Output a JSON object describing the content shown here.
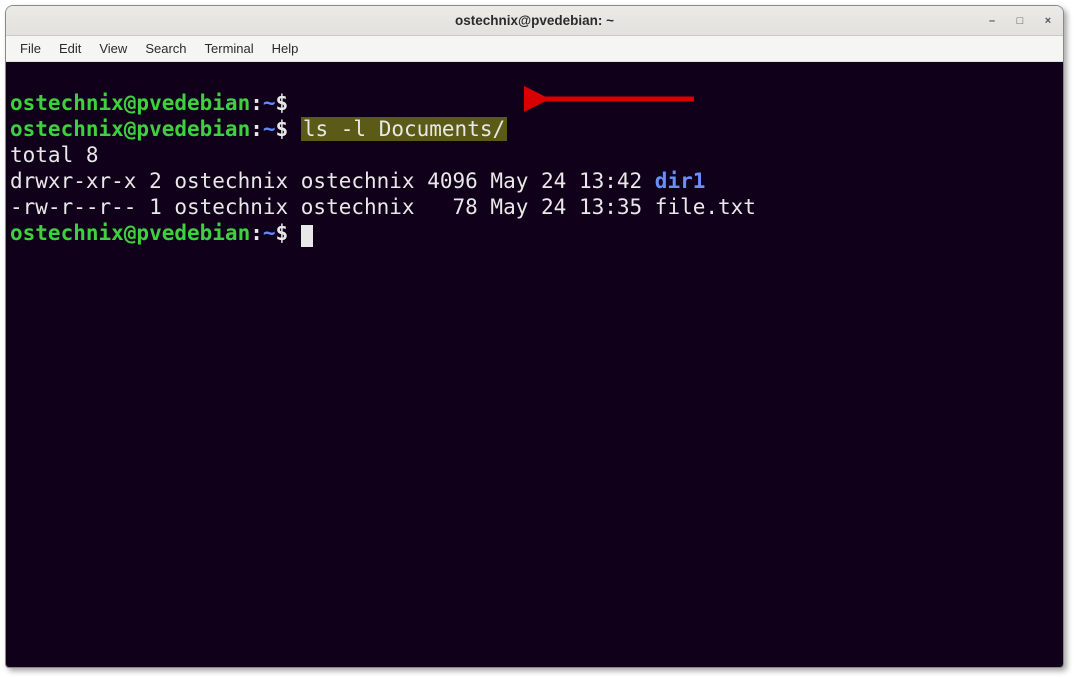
{
  "title": "ostechnix@pvedebian: ~",
  "menubar": [
    "File",
    "Edit",
    "View",
    "Search",
    "Terminal",
    "Help"
  ],
  "prompt": {
    "userhost": "ostechnix@pvedebian",
    "colon": ":",
    "path": "~",
    "dollar": "$"
  },
  "lines": {
    "cmd1": "",
    "cmd2_highlight": "ls -l Documents/",
    "total": "total 8",
    "row1_pre": "drwxr-xr-x 2 ostechnix ostechnix 4096 May 24 13:42 ",
    "row1_name": "dir1",
    "row2": "-rw-r--r-- 1 ostechnix ostechnix   78 May 24 13:35 file.txt"
  },
  "win_controls": {
    "min": "–",
    "max": "□",
    "close": "×"
  }
}
